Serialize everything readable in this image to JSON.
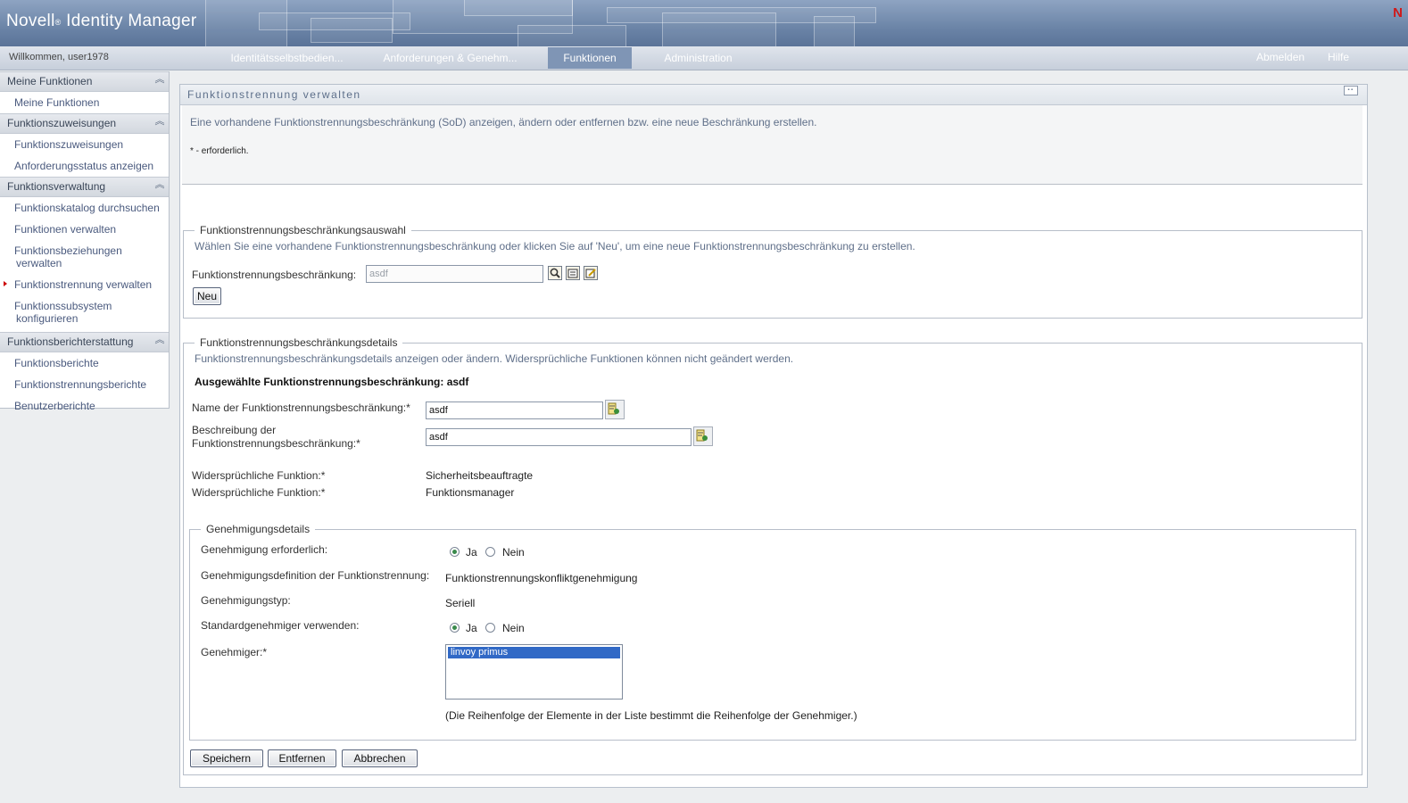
{
  "header": {
    "brand_name": "Novell",
    "brand_mark": "®",
    "product": "Identity Manager",
    "logo_letter": "N"
  },
  "navbar": {
    "welcome": "Willkommen, user1978",
    "tabs": [
      {
        "label": "Identitätsselbstbedien..."
      },
      {
        "label": "Anforderungen & Genehm..."
      },
      {
        "label": "Funktionen",
        "active": true
      },
      {
        "label": "Administration"
      }
    ],
    "logout": "Abmelden",
    "help": "Hilfe"
  },
  "sidebar": {
    "sections": [
      {
        "title": "Meine Funktionen",
        "items": [
          "Meine Funktionen"
        ]
      },
      {
        "title": "Funktionszuweisungen",
        "items": [
          "Funktionszuweisungen",
          "Anforderungsstatus anzeigen"
        ]
      },
      {
        "title": "Funktionsverwaltung",
        "items": [
          "Funktionskatalog durchsuchen",
          "Funktionen verwalten",
          "Funktionsbeziehungen verwalten",
          "Funktionstrennung verwalten",
          "Funktionssubsystem konfigurieren"
        ]
      },
      {
        "title": "Funktionsberichterstattung",
        "items": [
          "Funktionsberichte",
          "Funktionstrennungsberichte",
          "Benutzerberichte"
        ]
      }
    ],
    "item_lines": {
      "beziehungen_1": "Funktionsbeziehungen",
      "beziehungen_2": "verwalten",
      "subsystem_1": "Funktionssubsystem",
      "subsystem_2": "konfigurieren"
    },
    "active_item": "Funktionstrennung verwalten",
    "active_marker_color": "#cc0000"
  },
  "panel": {
    "title": "Funktionstrennung verwalten",
    "intro": "Eine vorhandene Funktionstrennungsbeschränkung (SoD) anzeigen, ändern oder entfernen bzw. eine neue Beschränkung erstellen.",
    "required_note": "* - erforderlich."
  },
  "selection": {
    "legend": "Funktionstrennungsbeschränkungsauswahl",
    "hint": "Wählen Sie eine vorhandene Funktionstrennungsbeschränkung oder klicken Sie auf 'Neu', um eine neue Funktionstrennungsbeschränkung zu erstellen.",
    "field_label": "Funktionstrennungsbeschränkung:",
    "field_value": "asdf",
    "new_button": "Neu",
    "icons": [
      "search-icon",
      "history-icon",
      "edit-icon"
    ]
  },
  "details": {
    "legend": "Funktionstrennungsbeschränkungsdetails",
    "hint": "Funktionstrennungsbeschränkungsdetails anzeigen oder ändern. Widersprüchliche Funktionen können nicht geändert werden.",
    "selected_heading": "Ausgewählte Funktionstrennungsbeschränkung: asdf",
    "name_label": "Name der Funktionstrennungsbeschränkung:*",
    "name_value": "asdf",
    "desc_label_1": "Beschreibung der",
    "desc_label_2": "Funktionstrennungsbeschränkung:*",
    "desc_value": "asdf",
    "conflicts": [
      {
        "label": "Widersprüchliche Funktion:*",
        "value": "Sicherheitsbeauftragte"
      },
      {
        "label": "Widersprüchliche Funktion:*",
        "value": "Funktionsmanager"
      }
    ]
  },
  "approval": {
    "legend": "Genehmigungsdetails",
    "required_label": "Genehmigung erforderlich:",
    "yes": "Ja",
    "no": "Nein",
    "required_selected": "Ja",
    "definition_label": "Genehmigungsdefinition der Funktionstrennung:",
    "definition_value": "Funktionstrennungskonfliktgenehmigung",
    "type_label": "Genehmigungstyp:",
    "type_value": "Seriell",
    "default_label": "Standardgenehmiger verwenden:",
    "default_selected": "Ja",
    "approvers_label": "Genehmiger:*",
    "approvers": [
      "linvoy primus"
    ],
    "order_note": "(Die Reihenfolge der Elemente in der Liste bestimmt die Reihenfolge der Genehmiger.)"
  },
  "actions": {
    "save": "Speichern",
    "remove": "Entfernen",
    "cancel": "Abbrechen"
  },
  "colors": {
    "banner": "#6b84a7",
    "active_tab": "#7f95b5",
    "selection": "#3169c6"
  }
}
